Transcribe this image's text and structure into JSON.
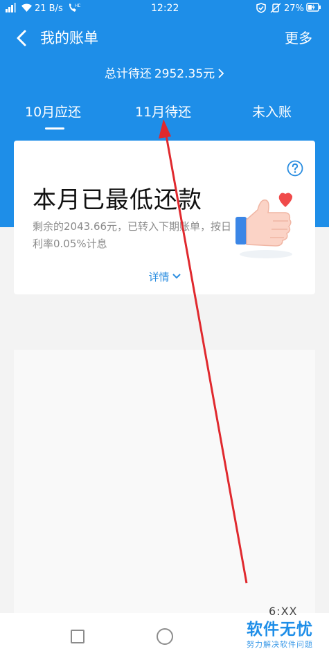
{
  "status_bar": {
    "speed": "21 B/s",
    "time": "12:22",
    "battery": "27%"
  },
  "nav": {
    "title": "我的账单",
    "more": "更多"
  },
  "summary": {
    "label": "总计待还",
    "amount": "2952.35元"
  },
  "tabs": [
    {
      "label": "10月应还",
      "selected": true
    },
    {
      "label": "11月待还",
      "selected": false
    },
    {
      "label": "未入账",
      "selected": false
    }
  ],
  "card": {
    "title": "本月已最低还款",
    "description": "剩余的2043.66元，已转入下期账单，按日利率0.05%计息",
    "details": "详情"
  },
  "bottom_nav": {
    "partial_text": "6:XX"
  },
  "watermark": {
    "main": "软件无忧",
    "sub": "努力解决软件问题"
  },
  "colors": {
    "primary_blue": "#1e8ee8",
    "annotation_red": "#e0292e",
    "link_blue": "#2a8de0"
  }
}
